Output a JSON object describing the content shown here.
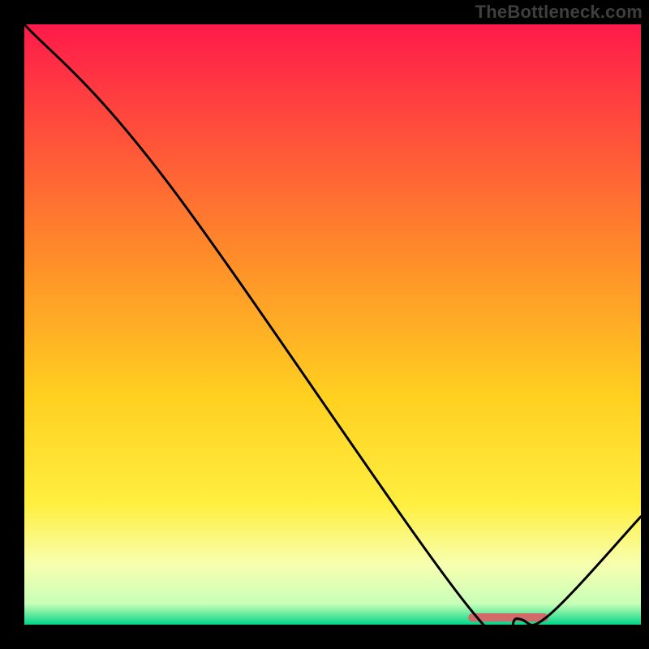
{
  "watermark": "TheBottleneck.com",
  "chart_data": {
    "type": "line",
    "title": "",
    "xlabel": "",
    "ylabel": "",
    "xlim": [
      0,
      100
    ],
    "ylim": [
      0,
      100
    ],
    "grid": false,
    "legend": false,
    "background_gradient": {
      "stops": [
        {
          "pos": 0.0,
          "color": "#ff1a4a"
        },
        {
          "pos": 0.38,
          "color": "#ff8a2a"
        },
        {
          "pos": 0.62,
          "color": "#ffd020"
        },
        {
          "pos": 0.8,
          "color": "#ffef40"
        },
        {
          "pos": 0.9,
          "color": "#f7ffb0"
        },
        {
          "pos": 0.965,
          "color": "#c8ffb8"
        },
        {
          "pos": 0.985,
          "color": "#58e89a"
        },
        {
          "pos": 1.0,
          "color": "#00d488"
        }
      ]
    },
    "series": [
      {
        "name": "bottleneck-curve",
        "type": "line",
        "color": "#000000",
        "x": [
          0,
          23,
          72,
          80,
          85,
          100
        ],
        "y": [
          100,
          74,
          3,
          1,
          1.5,
          18
        ]
      }
    ],
    "annotations": [
      {
        "name": "optimal-marker",
        "type": "bar-segment",
        "color": "#d36a6a",
        "x_start": 72,
        "x_end": 85,
        "y": 1.2,
        "thickness_pct": 1.4
      }
    ]
  }
}
